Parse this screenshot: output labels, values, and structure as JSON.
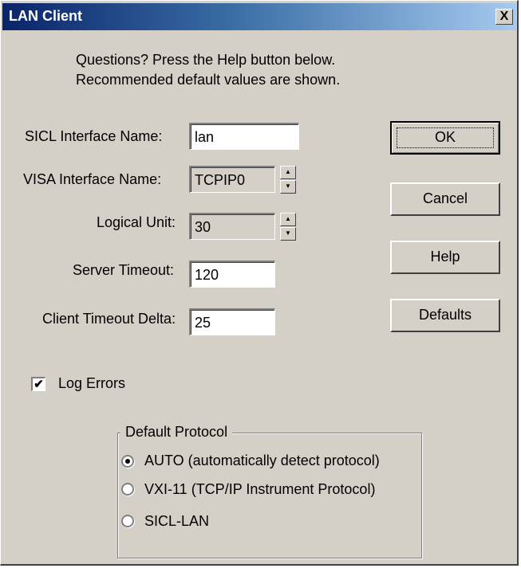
{
  "window": {
    "title": "LAN Client",
    "close_label": "X"
  },
  "intro": {
    "line1": "Questions?  Press the Help button below.",
    "line2": "Recommended default values are shown."
  },
  "fields": {
    "sicl_label": "SICL Interface Name:",
    "sicl_value": "lan",
    "visa_label": "VISA Interface Name:",
    "visa_value": "TCPIP0",
    "logical_label": "Logical Unit:",
    "logical_value": "30",
    "server_label": "Server Timeout:",
    "server_value": "120",
    "client_label": "Client Timeout Delta:",
    "client_value": "25"
  },
  "buttons": {
    "ok": "OK",
    "cancel": "Cancel",
    "help": "Help",
    "defaults": "Defaults"
  },
  "log_errors": {
    "label": "Log Errors",
    "checked": true,
    "check_glyph": "✔"
  },
  "protocol": {
    "group_label": "Default Protocol",
    "options": [
      {
        "label": "AUTO (automatically detect protocol)",
        "selected": true
      },
      {
        "label": "VXI-11 (TCP/IP Instrument Protocol)",
        "selected": false
      },
      {
        "label": "SICL-LAN",
        "selected": false
      }
    ]
  },
  "colors": {
    "face": "#d4d0c8",
    "title_start": "#0a246a",
    "title_end": "#a6caf0"
  }
}
